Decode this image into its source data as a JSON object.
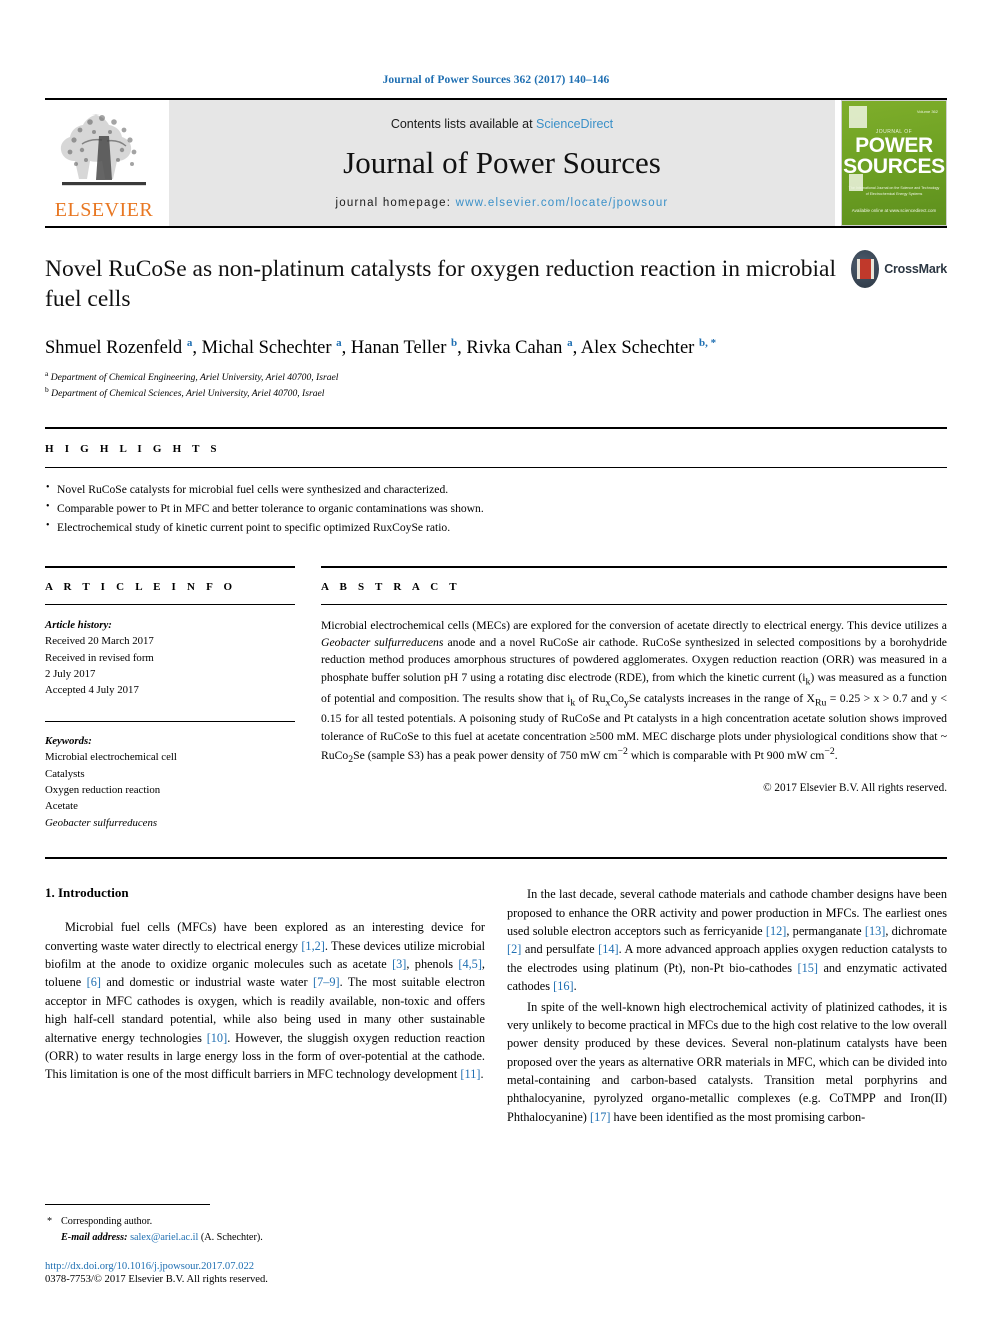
{
  "running_head": "Journal of Power Sources 362 (2017) 140–146",
  "masthead": {
    "contents_prefix": "Contents lists available at ",
    "contents_link": "ScienceDirect",
    "journal_name": "Journal of Power Sources",
    "homepage_prefix": "journal homepage: ",
    "homepage_url": "www.elsevier.com/locate/jpowsour",
    "publisher_logo_text": "ELSEVIER",
    "cover": {
      "top_text": "ISSN 0378-7753",
      "issn": "Volume 362",
      "sub": "JOURNAL OF",
      "title_line1": "POWER",
      "title_line2": "SOURCES",
      "caption": "The International Journal on the Science and Technology of Electrochemical Energy Systems",
      "bottom": "Available online at www.sciencedirect.com"
    }
  },
  "article": {
    "title": "Novel RuCoSe as non-platinum catalysts for oxygen reduction reaction in microbial fuel cells",
    "crossmark_label": "CrossMark",
    "authors": [
      {
        "name": "Shmuel Rozenfeld",
        "mark": "a",
        "sep": ", "
      },
      {
        "name": "Michal Schechter",
        "mark": "a",
        "sep": ", "
      },
      {
        "name": "Hanan Teller",
        "mark": "b",
        "sep": ", "
      },
      {
        "name": "Rivka Cahan",
        "mark": "a",
        "sep": ", "
      },
      {
        "name": "Alex Schechter",
        "mark": "b, *",
        "sep": ""
      }
    ],
    "affiliations": [
      {
        "mark": "a",
        "text": "Department of Chemical Engineering, Ariel University, Ariel 40700, Israel"
      },
      {
        "mark": "b",
        "text": "Department of Chemical Sciences, Ariel University, Ariel 40700, Israel"
      }
    ]
  },
  "highlights": {
    "heading": "H I G H L I G H T S",
    "items": [
      "Novel RuCoSe catalysts for microbial fuel cells were synthesized and characterized.",
      "Comparable power to Pt in MFC and better tolerance to organic contaminations was shown.",
      "Electrochemical study of kinetic current point to specific optimized RuxCoySe ratio."
    ]
  },
  "article_info": {
    "heading": "A R T I C L E   I N F O",
    "history_label": "Article history:",
    "history": [
      "Received 20 March 2017",
      "Received in revised form",
      "2 July 2017",
      "Accepted 4 July 2017"
    ],
    "keywords_label": "Keywords:",
    "keywords": [
      {
        "text": "Microbial electrochemical cell",
        "italic": false
      },
      {
        "text": "Catalysts",
        "italic": false
      },
      {
        "text": "Oxygen reduction reaction",
        "italic": false
      },
      {
        "text": "Acetate",
        "italic": false
      },
      {
        "text": "Geobacter sulfurreducens",
        "italic": true
      }
    ]
  },
  "abstract": {
    "heading": "A B S T R A C T",
    "part1": "Microbial electrochemical cells (MECs) are explored for the conversion of acetate directly to electrical energy. This device utilizes a ",
    "italic1": "Geobacter sulfurreducens",
    "part2": " anode and a novel RuCoSe air cathode. RuCoSe synthesized in selected compositions by a borohydride reduction method produces amorphous structures of powdered agglomerates. Oxygen reduction reaction (ORR) was measured in a phosphate buffer solution pH 7 using a rotating disc electrode (RDE), from which the kinetic current (i",
    "sub1": "k",
    "part3": ") was measured as a function of potential and composition. The results show that i",
    "sub2": "k",
    "part4": " of Ru",
    "sub3": "x",
    "part5": "Co",
    "sub4": "y",
    "part6": "Se catalysts increases in the range of X",
    "sub5": "Ru",
    "part7": " = 0.25 > x > 0.7 and y < 0.15 for all tested potentials. A poisoning study of RuCoSe and Pt catalysts in a high concentration acetate solution shows improved tolerance of RuCoSe to this fuel at acetate concentration ≥500 mM. MEC discharge plots under physiological conditions show that ~ RuCo",
    "sub6": "2",
    "part8": "Se (sample S3) has a peak power density of 750 mW cm",
    "sup1": "−2",
    "part9": " which is comparable with Pt 900 mW cm",
    "sup2": "−2",
    "part10": ".",
    "copyright": "© 2017 Elsevier B.V. All rights reserved."
  },
  "introduction": {
    "section_number": "1.",
    "section_title": "Introduction",
    "left_paragraphs": [
      {
        "segments": [
          {
            "t": "Microbial fuel cells (MFCs) have been explored as an interesting device for converting waste water directly to electrical energy "
          },
          {
            "t": "[1,2]",
            "ref": true
          },
          {
            "t": ". These devices utilize microbial biofilm at the anode to oxidize organic molecules such as acetate "
          },
          {
            "t": "[3]",
            "ref": true
          },
          {
            "t": ", phenols "
          },
          {
            "t": "[4,5]",
            "ref": true
          },
          {
            "t": ", toluene "
          },
          {
            "t": "[6]",
            "ref": true
          },
          {
            "t": " and domestic or industrial waste water "
          },
          {
            "t": "[7–9]",
            "ref": true
          },
          {
            "t": ". The most suitable electron acceptor in MFC cathodes is oxygen, which is readily available, non-toxic and offers high half-cell standard potential, while also being used in many other sustainable alternative energy technologies "
          },
          {
            "t": "[10]",
            "ref": true
          },
          {
            "t": ". However, the sluggish oxygen reduction reaction (ORR) to water results in large energy loss in the form of over-potential at the cathode. This limitation is one of the most difficult barriers in MFC technology development "
          },
          {
            "t": "[11]",
            "ref": true
          },
          {
            "t": "."
          }
        ]
      }
    ],
    "right_paragraphs": [
      {
        "segments": [
          {
            "t": "In the last decade, several cathode materials and cathode chamber designs have been proposed to enhance the ORR activity and power production in MFCs. The earliest ones used soluble electron acceptors such as ferricyanide "
          },
          {
            "t": "[12]",
            "ref": true
          },
          {
            "t": ", permanganate "
          },
          {
            "t": "[13]",
            "ref": true
          },
          {
            "t": ", dichromate "
          },
          {
            "t": "[2]",
            "ref": true
          },
          {
            "t": " and persulfate "
          },
          {
            "t": "[14]",
            "ref": true
          },
          {
            "t": ". A more advanced approach applies oxygen reduction catalysts to the electrodes using platinum (Pt), non-Pt bio-cathodes "
          },
          {
            "t": "[15]",
            "ref": true
          },
          {
            "t": " and enzymatic activated cathodes "
          },
          {
            "t": "[16]",
            "ref": true
          },
          {
            "t": "."
          }
        ]
      },
      {
        "segments": [
          {
            "t": "In spite of the well-known high electrochemical activity of platinized cathodes, it is very unlikely to become practical in MFCs due to the high cost relative to the low overall power density produced by these devices. Several non-platinum catalysts have been proposed over the years as alternative ORR materials in MFC, which can be divided into metal-containing and carbon-based catalysts. Transition metal porphyrins and phthalocyanine, pyrolyzed organo-metallic complexes (e.g. CoTMPP and Iron(II) Phthalocyanine) "
          },
          {
            "t": "[17]",
            "ref": true
          },
          {
            "t": " have been identified as the most promising carbon-"
          }
        ]
      }
    ]
  },
  "footnote": {
    "star": "*",
    "corresponding": "Corresponding author.",
    "email_label": "E-mail address:",
    "email": "salex@ariel.ac.il",
    "email_suffix": " (A. Schechter).",
    "doi": "http://dx.doi.org/10.1016/j.jpowsour.2017.07.022",
    "issn": "0378-7753/© 2017 Elsevier B.V. All rights reserved."
  },
  "colors": {
    "link": "#1f6fb2",
    "elsevier_orange": "#e87722",
    "cover_green": "#6fa224"
  }
}
